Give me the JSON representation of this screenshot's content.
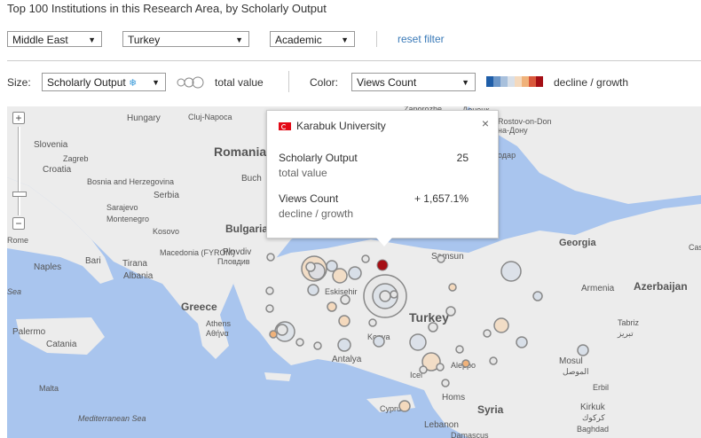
{
  "title": "Top 100 Institutions in this Research Area, by Scholarly Output",
  "filters": {
    "region": "Middle East",
    "country": "Turkey",
    "sector": "Academic",
    "reset_label": "reset filter"
  },
  "controls": {
    "size_label": "Size:",
    "size_value": "Scholarly Output",
    "size_legend": "total value",
    "color_label": "Color:",
    "color_value": "Views Count",
    "color_legend": "decline / growth",
    "swatch_colors": [
      "#1f5ea8",
      "#6b96c8",
      "#a8c0dc",
      "#d8dfe8",
      "#f4d9bd",
      "#f0b27a",
      "#d9583b",
      "#a50f15"
    ]
  },
  "popup": {
    "institution": "Karabuk University",
    "metric1_label": "Scholarly Output",
    "metric1_sub": "total value",
    "metric1_value": "25",
    "metric2_label": "Views Count",
    "metric2_sub": "decline / growth",
    "metric2_value": "+ 1,657.1%",
    "close": "×"
  },
  "map": {
    "zoom_in": "+",
    "zoom_out": "−",
    "places": [
      "Hungary",
      "Cluj-Napoca",
      "Slovenia",
      "Zagreb",
      "Croatia",
      "Bosnia and Herzegovina",
      "Serbia",
      "Romania",
      "Buch",
      "Sarajevo",
      "Montenegro",
      "Kosovo",
      "Bulgaria",
      "Plovdiv",
      "Пловдив",
      "Macedonia (FYROM)",
      "Bari",
      "Tirana",
      "Albania",
      "Naples",
      "Rome",
      "Greece",
      "Athens",
      "Αθήνα",
      "Palermo",
      "Catania",
      "Malta",
      "Mediterranean Sea",
      "Sea",
      "Eskisehir",
      "Antalya",
      "Konya",
      "Icel",
      "Turkey",
      "Samsun",
      "Georgia",
      "Armenia",
      "Azerbaijan",
      "Tabriz",
      "تبریز",
      "Homs",
      "Syria",
      "Mosul",
      "الموصل",
      "Erbil",
      "Kirkuk",
      "كركوك",
      "Cyprus",
      "Lebanon",
      "Baghdad",
      "Damascus",
      "Aleppo",
      "Casp",
      "Zaporozhe",
      "Донецк",
      "Rostov-on-Don",
      "на-Дону",
      "одар"
    ]
  }
}
